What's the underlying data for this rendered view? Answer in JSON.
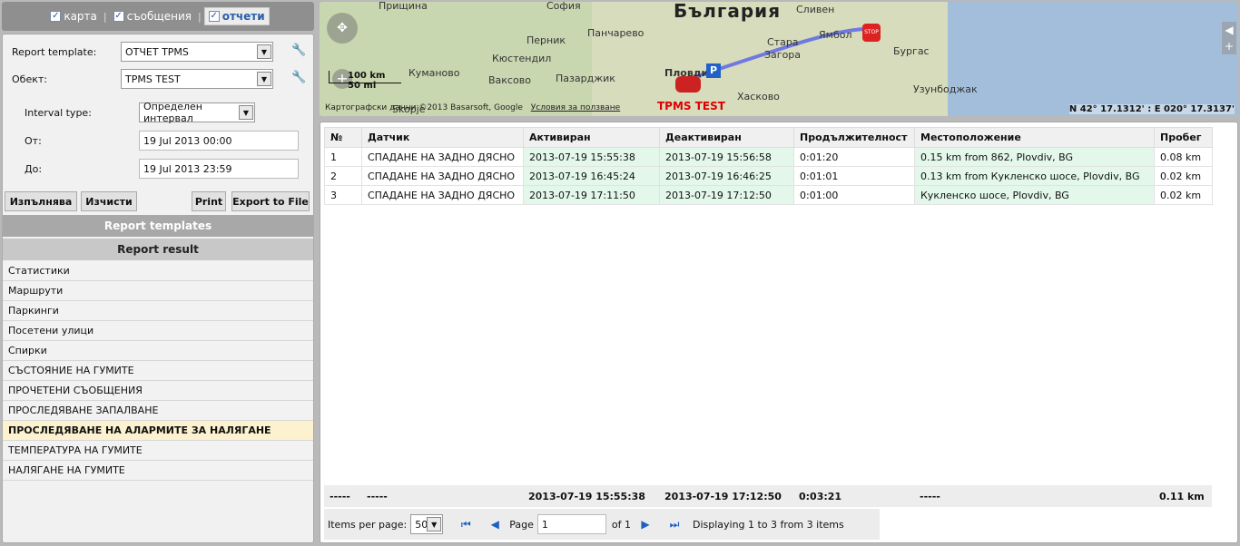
{
  "tabs": [
    {
      "label": "карта",
      "checked": true,
      "active": false
    },
    {
      "label": "съобщения",
      "checked": true,
      "active": false
    },
    {
      "label": "отчети",
      "checked": true,
      "active": true
    }
  ],
  "form": {
    "template_label": "Report template:",
    "template_value": "ОТЧЕТ TPMS",
    "object_label": "Обект:",
    "object_value": "TPMS TEST",
    "interval_label": "Interval type:",
    "interval_value": "Определен интервал",
    "from_label": "От:",
    "from_value": "19 Jul 2013 00:00",
    "to_label": "До:",
    "to_value": "19 Jul 2013 23:59"
  },
  "buttons": {
    "execute": "Изпълнява",
    "clear": "Изчисти",
    "print": "Print",
    "export": "Export to File"
  },
  "sections": {
    "templates": "Report templates",
    "result": "Report result"
  },
  "result_items": [
    "Статистики",
    "Маршрути",
    "Паркинги",
    "Посетени улици",
    "Спирки",
    "СЪСТОЯНИЕ НА ГУМИТЕ",
    "ПРОЧЕТЕНИ СЪОБЩЕНИЯ",
    "ПРОСЛЕДЯВАНЕ ЗАПАЛВАНЕ",
    "ПРОСЛЕДЯВАНЕ НА АЛАРМИТЕ ЗА НАЛЯГАНЕ",
    "ТЕМПЕРАТУРА НА ГУМИТЕ",
    "НАЛЯГАНЕ НА ГУМИТЕ"
  ],
  "selected_result_index": 8,
  "map": {
    "country": "България",
    "places": [
      "София",
      "Сливен",
      "Перник",
      "Панчарево",
      "Кюстендил",
      "Стара",
      "Загора",
      "Ямбол",
      "Бургас",
      "Пазарджик",
      "Пловдив",
      "Хасково",
      "Кумaново",
      "Вакcoвo",
      "Узунбоджак",
      "Прищина",
      "Skopje"
    ],
    "vehicle_label": "TPMS TEST",
    "coords": "N 42° 17.1312' : E 020° 17.3137'",
    "scale_km": "100 km",
    "scale_mi": "50 mi",
    "copyright": "Картографски данни ©2013 Basarsoft, Google",
    "terms": "Условия за ползване"
  },
  "table": {
    "columns": [
      "№",
      "Датчик",
      "Активиран",
      "Деактивиран",
      "Продължителност",
      "Местоположение",
      "Пробег"
    ],
    "rows": [
      [
        "1",
        "СПАДАНЕ НА ЗАДНО ДЯСНО",
        "2013-07-19 15:55:38",
        "2013-07-19 15:56:58",
        "0:01:20",
        "0.15 km from 862, Plovdiv, BG",
        "0.08 km"
      ],
      [
        "2",
        "СПАДАНЕ НА ЗАДНО ДЯСНО",
        "2013-07-19 16:45:24",
        "2013-07-19 16:46:25",
        "0:01:01",
        "0.13 km from Кукленско шосе, Plovdiv, BG",
        "0.02 km"
      ],
      [
        "3",
        "СПАДАНЕ НА ЗАДНО ДЯСНО",
        "2013-07-19 17:11:50",
        "2013-07-19 17:12:50",
        "0:01:00",
        "Кукленско шосе, Plovdiv, BG",
        "0.02 km"
      ]
    ],
    "footer": [
      "-----",
      "-----",
      "2013-07-19 15:55:38",
      "2013-07-19 17:12:50",
      "0:03:21",
      "-----",
      "0.11 km"
    ]
  },
  "pager": {
    "items_per_page_label": "Items per page:",
    "items_per_page": "50",
    "page_label": "Page",
    "page_value": "1",
    "of_label": "of 1",
    "display_text": "Displaying 1 to 3 from 3 items"
  },
  "colors": {
    "accent": "#2a5ea8",
    "green_cell": "#e3f8ea",
    "selected_item": "#fdf2d0",
    "vehicle_label": "#dd0000"
  }
}
